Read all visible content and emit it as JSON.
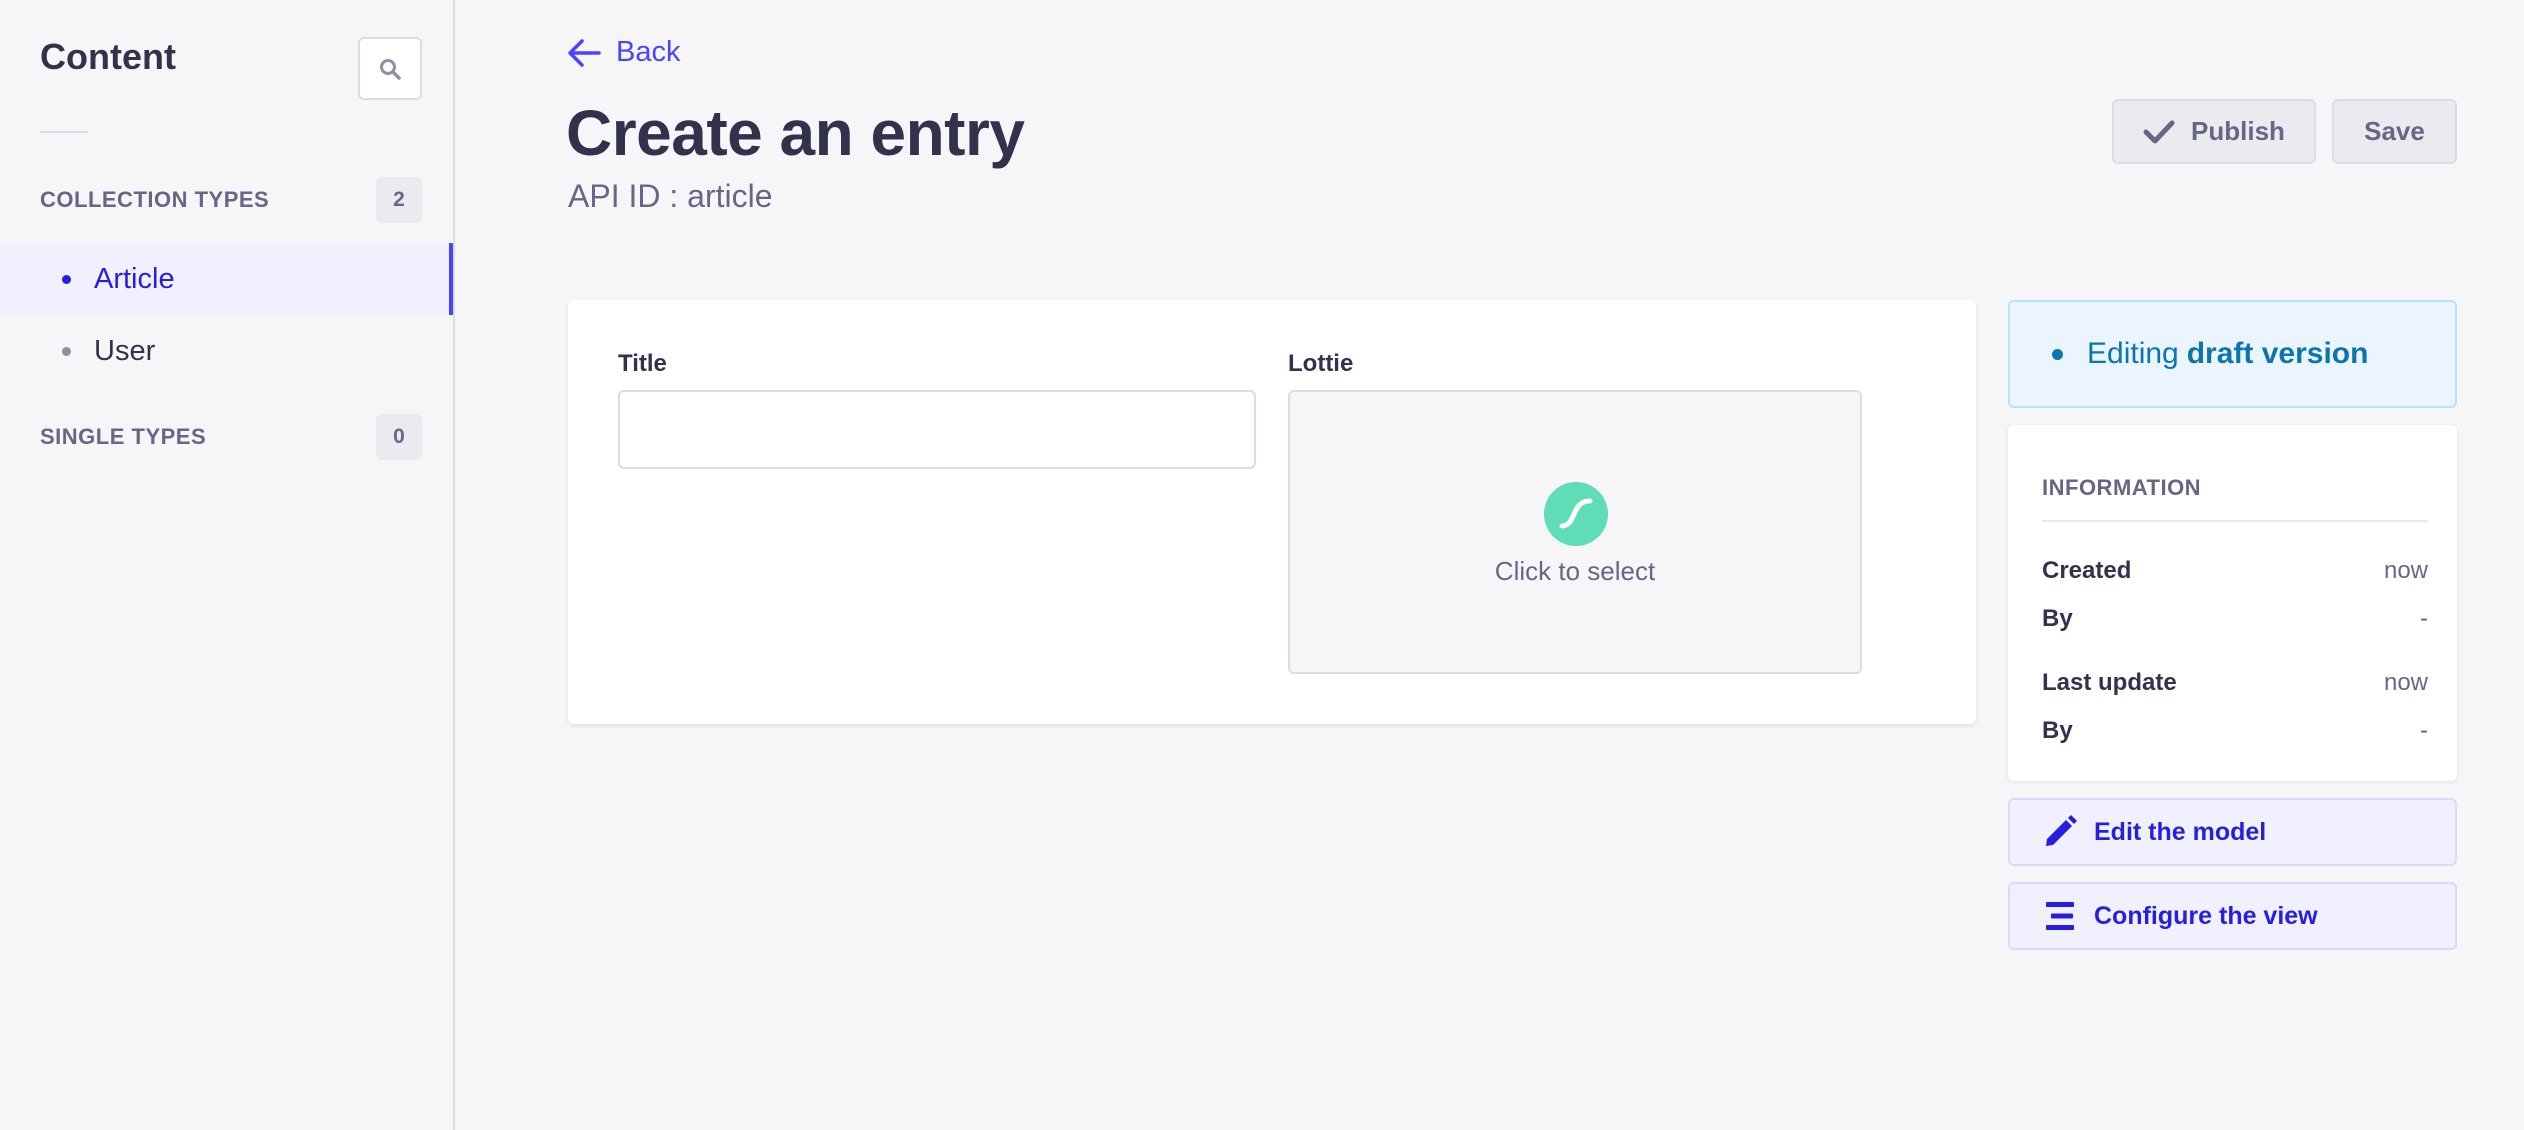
{
  "sidebar": {
    "title": "Content",
    "search_icon": "search-icon",
    "collection_types": {
      "label": "COLLECTION TYPES",
      "count": "2",
      "items": [
        {
          "label": "Article",
          "active": true
        },
        {
          "label": "User",
          "active": false
        }
      ]
    },
    "single_types": {
      "label": "SINGLE TYPES",
      "count": "0"
    }
  },
  "header": {
    "back_label": "Back",
    "title": "Create an entry",
    "subtitle": "API ID : article",
    "publish_label": "Publish",
    "save_label": "Save"
  },
  "form": {
    "title_label": "Title",
    "title_value": "",
    "lottie_label": "Lottie",
    "lottie_placeholder": "Click to select"
  },
  "status": {
    "prefix": "Editing",
    "strong": "draft version"
  },
  "information": {
    "title": "INFORMATION",
    "rows": [
      {
        "key": "Created",
        "value": "now"
      },
      {
        "key": "By",
        "value": "-"
      },
      {
        "key": "Last update",
        "value": "now"
      },
      {
        "key": "By",
        "value": "-"
      }
    ]
  },
  "actions": {
    "edit_model": "Edit the model",
    "configure_view": "Configure the view"
  },
  "colors": {
    "primary": "#4945ff",
    "primary_dark": "#271fe0",
    "text": "#32324d",
    "muted": "#666687",
    "background": "#f6f6f9",
    "lottie_green": "#5fddb6",
    "draft_blue": "#0c75af"
  }
}
